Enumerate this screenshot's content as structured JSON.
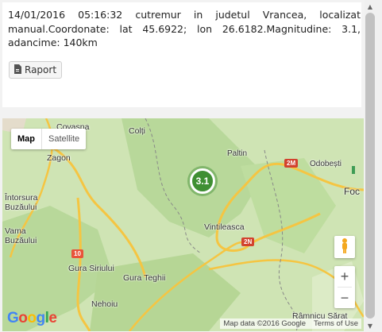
{
  "event": {
    "description": "14/01/2016 05:16:32 cutremur in judetul Vrancea, localizat manual.Coordonate: lat 45.6922; lon 26.6182.Magnitudine: 3.1, adancime: 140km",
    "report_button": "Raport"
  },
  "map": {
    "type_control": {
      "map": "Map",
      "satellite": "Satellite",
      "selected": "Map"
    },
    "marker_label": "3.1",
    "zoom_in": "+",
    "zoom_out": "−",
    "attribution": {
      "logo": "Google",
      "data": "Map data ©2016 Google",
      "terms": "Terms of Use"
    },
    "places": [
      "Covasna",
      "Zagon",
      "Paltin",
      "Odobești",
      "Foc",
      "Întorsura Buzăului",
      "Vama Buzăului",
      "Vintileasca",
      "Colți",
      "Gura Siriului",
      "Gura Teghii",
      "Nehoiu",
      "Râmnicu Sărat"
    ],
    "roads": [
      "2M",
      "2N",
      "10"
    ]
  },
  "colors": {
    "marker": "#3f8f33",
    "land": "#cfe4b4",
    "forest": "#b8d89a",
    "road_major": "#f5c542",
    "road_shield": "#d2422e"
  }
}
